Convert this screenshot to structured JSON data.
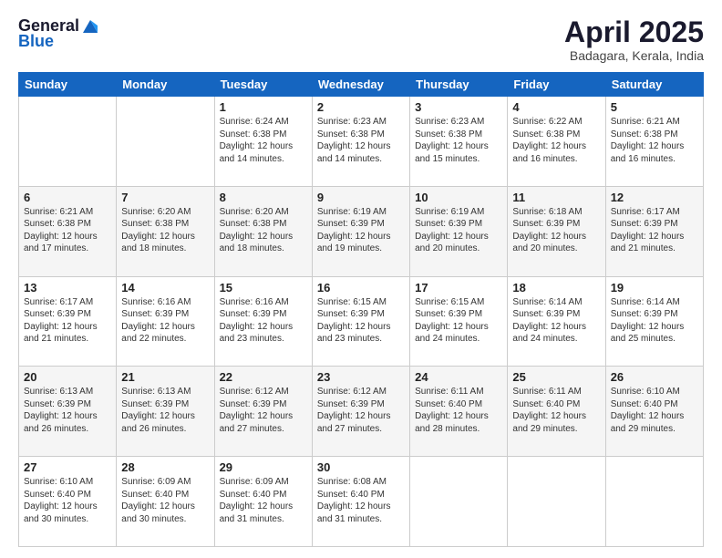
{
  "header": {
    "logo_line1": "General",
    "logo_line2": "Blue",
    "title": "April 2025",
    "subtitle": "Badagara, Kerala, India"
  },
  "columns": [
    "Sunday",
    "Monday",
    "Tuesday",
    "Wednesday",
    "Thursday",
    "Friday",
    "Saturday"
  ],
  "weeks": [
    [
      {
        "day": "",
        "info": ""
      },
      {
        "day": "",
        "info": ""
      },
      {
        "day": "1",
        "info": "Sunrise: 6:24 AM\nSunset: 6:38 PM\nDaylight: 12 hours and 14 minutes."
      },
      {
        "day": "2",
        "info": "Sunrise: 6:23 AM\nSunset: 6:38 PM\nDaylight: 12 hours and 14 minutes."
      },
      {
        "day": "3",
        "info": "Sunrise: 6:23 AM\nSunset: 6:38 PM\nDaylight: 12 hours and 15 minutes."
      },
      {
        "day": "4",
        "info": "Sunrise: 6:22 AM\nSunset: 6:38 PM\nDaylight: 12 hours and 16 minutes."
      },
      {
        "day": "5",
        "info": "Sunrise: 6:21 AM\nSunset: 6:38 PM\nDaylight: 12 hours and 16 minutes."
      }
    ],
    [
      {
        "day": "6",
        "info": "Sunrise: 6:21 AM\nSunset: 6:38 PM\nDaylight: 12 hours and 17 minutes."
      },
      {
        "day": "7",
        "info": "Sunrise: 6:20 AM\nSunset: 6:38 PM\nDaylight: 12 hours and 18 minutes."
      },
      {
        "day": "8",
        "info": "Sunrise: 6:20 AM\nSunset: 6:38 PM\nDaylight: 12 hours and 18 minutes."
      },
      {
        "day": "9",
        "info": "Sunrise: 6:19 AM\nSunset: 6:39 PM\nDaylight: 12 hours and 19 minutes."
      },
      {
        "day": "10",
        "info": "Sunrise: 6:19 AM\nSunset: 6:39 PM\nDaylight: 12 hours and 20 minutes."
      },
      {
        "day": "11",
        "info": "Sunrise: 6:18 AM\nSunset: 6:39 PM\nDaylight: 12 hours and 20 minutes."
      },
      {
        "day": "12",
        "info": "Sunrise: 6:17 AM\nSunset: 6:39 PM\nDaylight: 12 hours and 21 minutes."
      }
    ],
    [
      {
        "day": "13",
        "info": "Sunrise: 6:17 AM\nSunset: 6:39 PM\nDaylight: 12 hours and 21 minutes."
      },
      {
        "day": "14",
        "info": "Sunrise: 6:16 AM\nSunset: 6:39 PM\nDaylight: 12 hours and 22 minutes."
      },
      {
        "day": "15",
        "info": "Sunrise: 6:16 AM\nSunset: 6:39 PM\nDaylight: 12 hours and 23 minutes."
      },
      {
        "day": "16",
        "info": "Sunrise: 6:15 AM\nSunset: 6:39 PM\nDaylight: 12 hours and 23 minutes."
      },
      {
        "day": "17",
        "info": "Sunrise: 6:15 AM\nSunset: 6:39 PM\nDaylight: 12 hours and 24 minutes."
      },
      {
        "day": "18",
        "info": "Sunrise: 6:14 AM\nSunset: 6:39 PM\nDaylight: 12 hours and 24 minutes."
      },
      {
        "day": "19",
        "info": "Sunrise: 6:14 AM\nSunset: 6:39 PM\nDaylight: 12 hours and 25 minutes."
      }
    ],
    [
      {
        "day": "20",
        "info": "Sunrise: 6:13 AM\nSunset: 6:39 PM\nDaylight: 12 hours and 26 minutes."
      },
      {
        "day": "21",
        "info": "Sunrise: 6:13 AM\nSunset: 6:39 PM\nDaylight: 12 hours and 26 minutes."
      },
      {
        "day": "22",
        "info": "Sunrise: 6:12 AM\nSunset: 6:39 PM\nDaylight: 12 hours and 27 minutes."
      },
      {
        "day": "23",
        "info": "Sunrise: 6:12 AM\nSunset: 6:39 PM\nDaylight: 12 hours and 27 minutes."
      },
      {
        "day": "24",
        "info": "Sunrise: 6:11 AM\nSunset: 6:40 PM\nDaylight: 12 hours and 28 minutes."
      },
      {
        "day": "25",
        "info": "Sunrise: 6:11 AM\nSunset: 6:40 PM\nDaylight: 12 hours and 29 minutes."
      },
      {
        "day": "26",
        "info": "Sunrise: 6:10 AM\nSunset: 6:40 PM\nDaylight: 12 hours and 29 minutes."
      }
    ],
    [
      {
        "day": "27",
        "info": "Sunrise: 6:10 AM\nSunset: 6:40 PM\nDaylight: 12 hours and 30 minutes."
      },
      {
        "day": "28",
        "info": "Sunrise: 6:09 AM\nSunset: 6:40 PM\nDaylight: 12 hours and 30 minutes."
      },
      {
        "day": "29",
        "info": "Sunrise: 6:09 AM\nSunset: 6:40 PM\nDaylight: 12 hours and 31 minutes."
      },
      {
        "day": "30",
        "info": "Sunrise: 6:08 AM\nSunset: 6:40 PM\nDaylight: 12 hours and 31 minutes."
      },
      {
        "day": "",
        "info": ""
      },
      {
        "day": "",
        "info": ""
      },
      {
        "day": "",
        "info": ""
      }
    ]
  ]
}
